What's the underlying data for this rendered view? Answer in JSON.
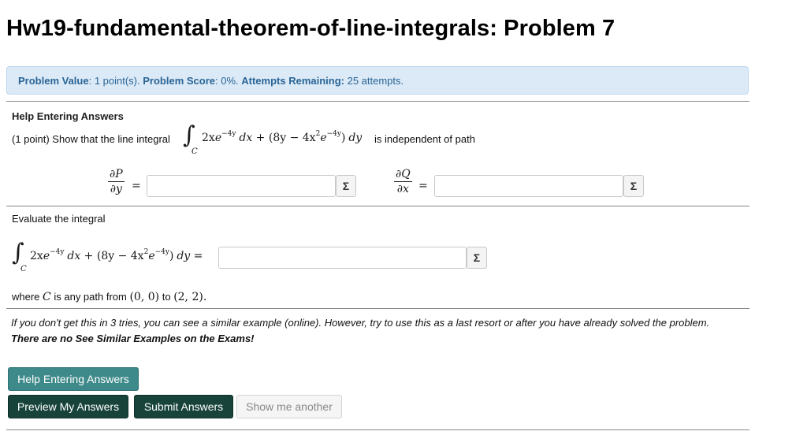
{
  "page": {
    "title": "Hw19-fundamental-theorem-of-line-integrals: Problem 7"
  },
  "info": {
    "value_label": "Problem Value",
    "value_text": ": 1 point(s). ",
    "score_label": "Problem Score",
    "score_text": ": 0%. ",
    "attempts_label": "Attempts Remaining:",
    "attempts_text": " 25 attempts."
  },
  "problem": {
    "help_heading": "Help Entering Answers",
    "statement_prefix": "(1 point) Show that the line integral",
    "statement_suffix": "is independent of path",
    "integrand": {
      "p_coef": "2x",
      "p_exp_base": "e",
      "p_exp": "−4y",
      "dx": "dx + ",
      "q_open": "(8y − 4x",
      "q_sq": "2",
      "q_e": "e",
      "q_exp": "−4y",
      "q_close": ")",
      "dy": "dy"
    },
    "c_sub": "C",
    "dP_num": "∂P",
    "dP_den": "∂y",
    "dQ_num": "∂Q",
    "dQ_den": "∂x",
    "equals": "=",
    "evaluate_label": "Evaluate the integral",
    "eval_equals": "dy =",
    "where_prefix": "where ",
    "where_C": "C",
    "where_mid": " is any path from ",
    "point_a": "(0, 0)",
    "where_to": " to ",
    "point_b": "(2, 2).",
    "note_line": "If you don't get this in 3 tries, you can see a similar example (online). However, try to use this as a last resort or after you have already solved the problem. ",
    "note_bold": "There are no See Similar Examples on the Exams!"
  },
  "inputs": {
    "dPdy_value": "",
    "dQdx_value": "",
    "integral_value": ""
  },
  "icons": {
    "sigma": "Σ"
  },
  "buttons": {
    "help": "Help Entering Answers",
    "preview": "Preview My Answers",
    "submit": "Submit Answers",
    "another": "Show me another"
  },
  "colors": {
    "info_bg": "#dbeaf6",
    "info_text": "#2a6496",
    "help_btn": "#3e8a8a",
    "primary_btn": "#17433a",
    "disabled_btn": "#f5f5f5"
  }
}
